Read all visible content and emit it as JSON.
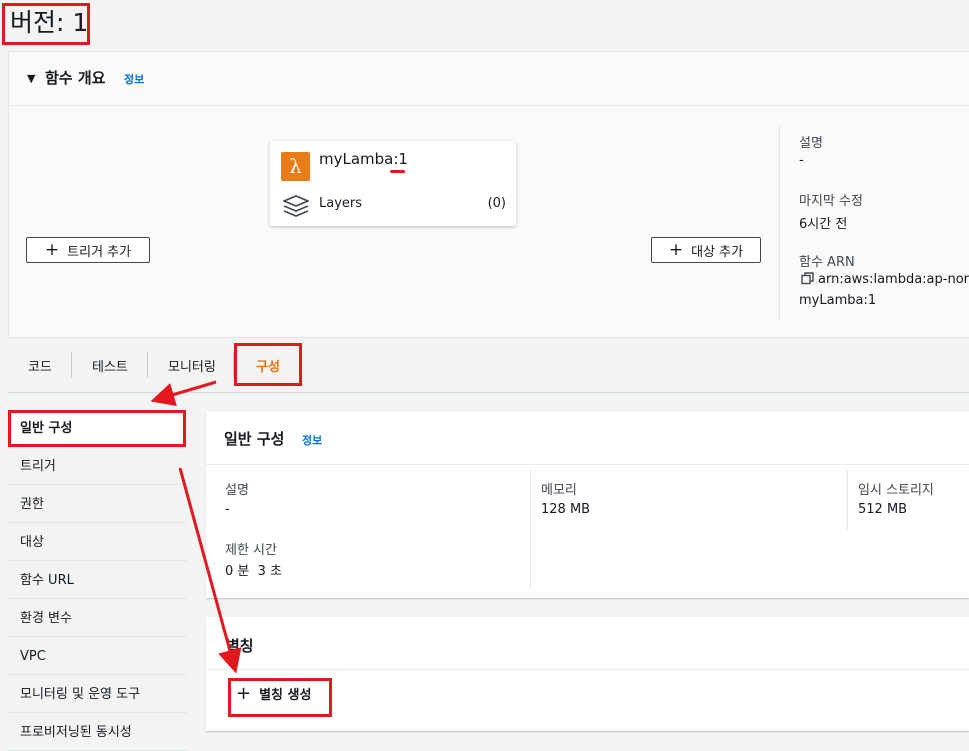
{
  "page": {
    "title": "버전: 1"
  },
  "overview": {
    "title": "함수 개요",
    "info": "정보",
    "function_name_prefix": "myLamba:",
    "function_version": "1",
    "layers_label": "Layers",
    "layers_count": "(0)",
    "add_trigger": "트리거 추가",
    "add_destination": "대상 추가",
    "description_label": "설명",
    "description_value": "-",
    "last_modified_label": "마지막 수정",
    "last_modified_value": "6시간 전",
    "arn_label": "함수 ARN",
    "arn_value": "arn:aws:lambda:ap-northe",
    "arn_value_2": "myLamba:1"
  },
  "tabs": [
    "코드",
    "테스트",
    "모니터링",
    "구성"
  ],
  "sidebar": {
    "items": [
      "일반 구성",
      "트리거",
      "권한",
      "대상",
      "함수 URL",
      "환경 변수",
      "VPC",
      "모니터링 및 운영 도구",
      "프로비저닝된 동시성"
    ]
  },
  "general_config": {
    "title": "일반 구성",
    "info": "정보",
    "description_label": "설명",
    "description_value": "-",
    "memory_label": "메모리",
    "memory_value": "128 MB",
    "storage_label": "임시 스토리지",
    "storage_value": "512 MB",
    "timeout_label": "제한 시간",
    "timeout_value": "0 분  3 초"
  },
  "alias": {
    "title": "별칭",
    "create_button": "별칭 생성"
  },
  "colors": {
    "accent": "#ec7211",
    "annotation": "#e3181e",
    "link": "#0972d3"
  }
}
